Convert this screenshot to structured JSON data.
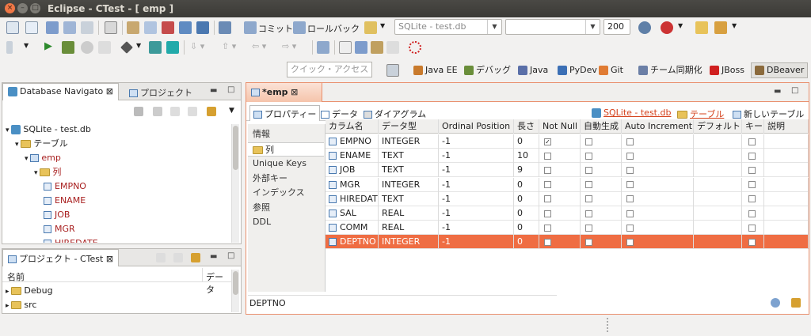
{
  "window": {
    "title": "Eclipse - CTest - [ emp ]",
    "close": "×",
    "minimize": "–",
    "maximize": "□"
  },
  "toolbar": {
    "commit_label": "コミット",
    "rollback_label": "ロールバック",
    "connection_combo": "SQLite - test.db",
    "schema_combo": "",
    "row_limit": "200",
    "quick_access_placeholder": "クイック・アクセス"
  },
  "perspectives": [
    {
      "label": "Java EE",
      "color": "#c97a2c"
    },
    {
      "label": "デバッグ",
      "color": "#6a8e3a"
    },
    {
      "label": "Java",
      "color": "#5a6fa8"
    },
    {
      "label": "PyDev",
      "color": "#3b6fb5"
    },
    {
      "label": "Git",
      "color": "#e07b33"
    },
    {
      "label": "チーム同期化",
      "color": "#6b7fa6"
    },
    {
      "label": "JBoss",
      "color": "#d02020"
    },
    {
      "label": "DBeaver",
      "color": "#8b6a3c"
    }
  ],
  "navigator": {
    "tab_active": "Database Navigato",
    "tab_other": "プロジェクト",
    "tree": [
      {
        "label": "SQLite - test.db",
        "level": 0,
        "kind": "db",
        "style": "normal"
      },
      {
        "label": "テーブル",
        "level": 1,
        "kind": "folder",
        "style": "normal"
      },
      {
        "label": "emp",
        "level": 2,
        "kind": "table",
        "style": "red"
      },
      {
        "label": "列",
        "level": 3,
        "kind": "folder",
        "style": "red"
      },
      {
        "label": "EMPNO",
        "level": 4,
        "kind": "col",
        "style": "red"
      },
      {
        "label": "ENAME",
        "level": 4,
        "kind": "col",
        "style": "red"
      },
      {
        "label": "JOB",
        "level": 4,
        "kind": "col",
        "style": "red"
      },
      {
        "label": "MGR",
        "level": 4,
        "kind": "col",
        "style": "red"
      },
      {
        "label": "HIREDATE",
        "level": 4,
        "kind": "col",
        "style": "red"
      }
    ]
  },
  "project_panel": {
    "title": "プロジェクト - CTest",
    "col_name": "名前",
    "col_data": "データ",
    "items": [
      "Debug",
      "src"
    ]
  },
  "editor": {
    "tab_title": "*emp",
    "subtabs": [
      "プロパティー",
      "データ",
      "ダイアグラム"
    ],
    "link_db": "SQLite - test.db",
    "link_tables": "テーブル",
    "new_table": "新しいテーブル",
    "side_items": [
      "情報",
      "列",
      "Unique Keys",
      "外部キー",
      "インデックス",
      "参照",
      "DDL"
    ],
    "side_selected": 1,
    "status_value": "DEPTNO"
  },
  "columns_table": {
    "headers": [
      "カラム名",
      "データ型",
      "Ordinal Position",
      "長さ",
      "Not Null",
      "自動生成",
      "Auto Increment",
      "デフォルト",
      "キー",
      "説明"
    ],
    "rows": [
      {
        "name": "EMPNO",
        "type": "INTEGER",
        "ordinal": "-1",
        "length": "0",
        "not_null": true,
        "auto_gen": false,
        "auto_inc": false,
        "key": false
      },
      {
        "name": "ENAME",
        "type": "TEXT",
        "ordinal": "-1",
        "length": "10",
        "not_null": false,
        "auto_gen": false,
        "auto_inc": false,
        "key": false
      },
      {
        "name": "JOB",
        "type": "TEXT",
        "ordinal": "-1",
        "length": "9",
        "not_null": false,
        "auto_gen": false,
        "auto_inc": false,
        "key": false
      },
      {
        "name": "MGR",
        "type": "INTEGER",
        "ordinal": "-1",
        "length": "0",
        "not_null": false,
        "auto_gen": false,
        "auto_inc": false,
        "key": false
      },
      {
        "name": "HIREDATE",
        "type": "TEXT",
        "ordinal": "-1",
        "length": "0",
        "not_null": false,
        "auto_gen": false,
        "auto_inc": false,
        "key": false
      },
      {
        "name": "SAL",
        "type": "REAL",
        "ordinal": "-1",
        "length": "0",
        "not_null": false,
        "auto_gen": false,
        "auto_inc": false,
        "key": false
      },
      {
        "name": "COMM",
        "type": "REAL",
        "ordinal": "-1",
        "length": "0",
        "not_null": false,
        "auto_gen": false,
        "auto_inc": false,
        "key": false
      },
      {
        "name": "DEPTNO",
        "type": "INTEGER",
        "ordinal": "-1",
        "length": "0",
        "not_null": false,
        "auto_gen": false,
        "auto_inc": false,
        "key": false
      }
    ],
    "selected_row": 7
  },
  "colors": {
    "accent": "#ef6d43",
    "link": "#d4401a",
    "titlebar": "#3b3a36"
  }
}
